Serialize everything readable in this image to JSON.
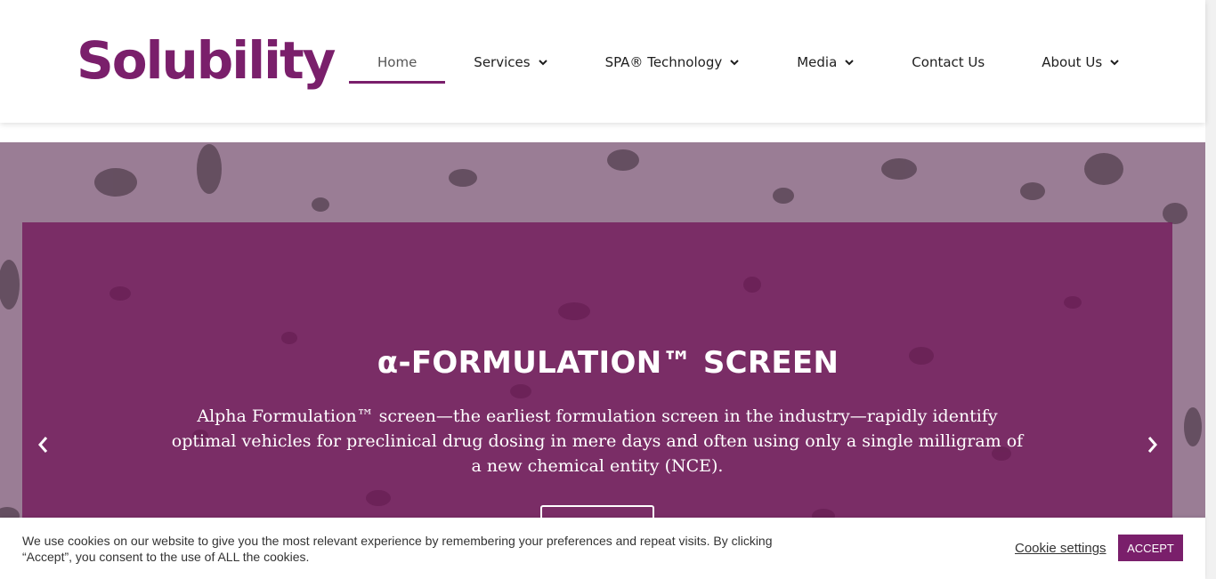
{
  "brand": {
    "logo_text": "Solubility",
    "color": "#7a1f6b"
  },
  "nav": {
    "items": [
      {
        "label": "Home",
        "active": true,
        "dropdown": false
      },
      {
        "label": "Services",
        "active": false,
        "dropdown": true
      },
      {
        "label": "SPA® Technology",
        "active": false,
        "dropdown": true
      },
      {
        "label": "Media",
        "active": false,
        "dropdown": true
      },
      {
        "label": "Contact Us",
        "active": false,
        "dropdown": false
      },
      {
        "label": "About Us",
        "active": false,
        "dropdown": true
      }
    ]
  },
  "hero": {
    "title": "α-FORMULATION™ SCREEN",
    "text": "Alpha Formulation™ screen—the earliest formulation screen in the industry—rapidly identify optimal vehicles for preclinical drug dosing in mere days and often using only a single milligram of a new chemical entity (NCE).",
    "prev_icon": "chevron-left-icon",
    "next_icon": "chevron-right-icon",
    "overlay_color": "#731c5c"
  },
  "cookie": {
    "text": "We use cookies on our website to give you the most relevant experience by remembering your preferences and repeat visits. By clicking “Accept”, you consent to the use of ALL the cookies.",
    "settings_label": "Cookie settings",
    "accept_label": "ACCEPT"
  }
}
